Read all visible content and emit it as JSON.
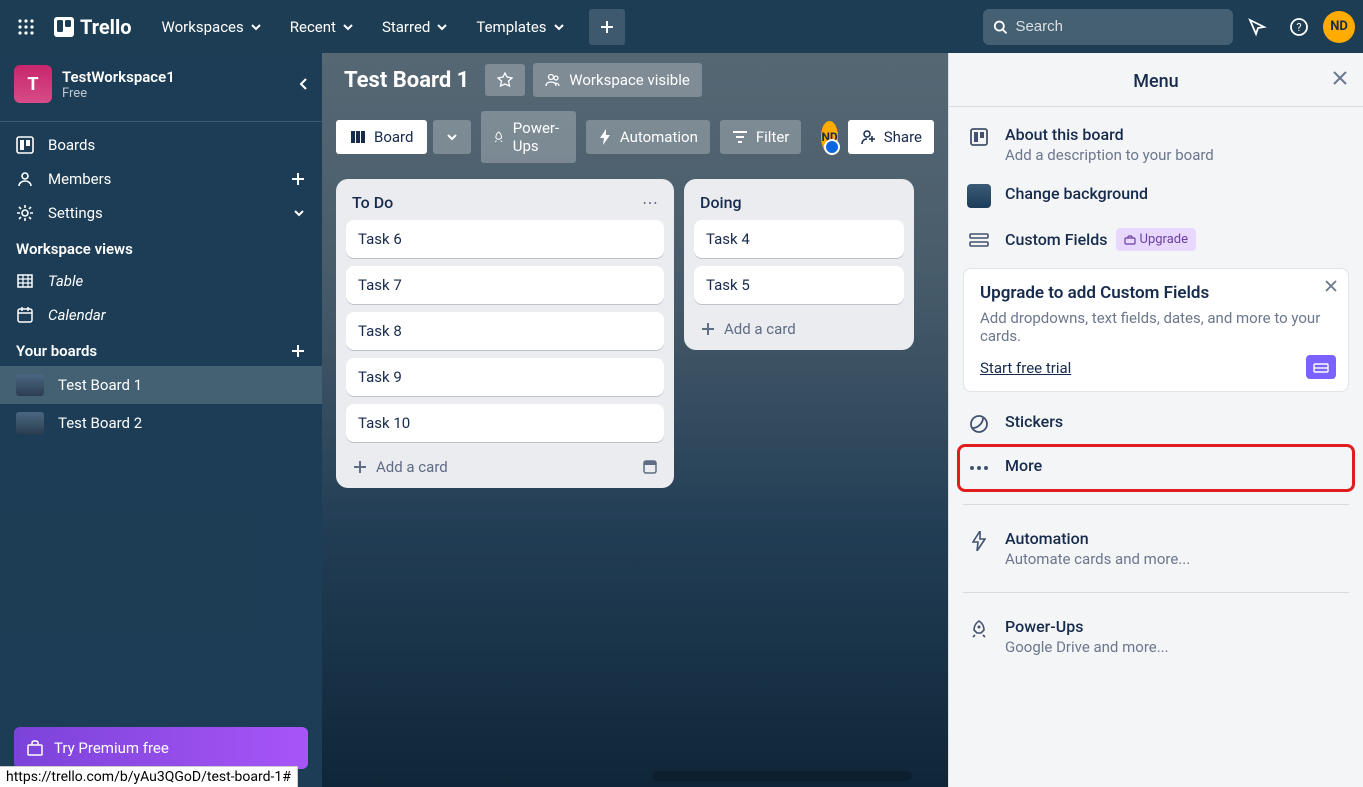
{
  "topbar": {
    "logo": "Trello",
    "nav": [
      "Workspaces",
      "Recent",
      "Starred",
      "Templates"
    ],
    "search_placeholder": "Search",
    "avatar": "ND"
  },
  "sidebar": {
    "workspace": {
      "initial": "T",
      "name": "TestWorkspace1",
      "plan": "Free"
    },
    "items": {
      "boards": "Boards",
      "members": "Members",
      "settings": "Settings"
    },
    "views_title": "Workspace views",
    "views": {
      "table": "Table",
      "calendar": "Calendar"
    },
    "boards_title": "Your boards",
    "boards": [
      "Test Board 1",
      "Test Board 2"
    ],
    "premium": "Try Premium free"
  },
  "board": {
    "title": "Test Board 1",
    "visibility": "Workspace visible",
    "view_label": "Board",
    "powerups": "Power-Ups",
    "automation": "Automation",
    "filter": "Filter",
    "share": "Share",
    "member": "ND"
  },
  "lists": [
    {
      "title": "To Do",
      "cards": [
        "Task 6",
        "Task 7",
        "Task 8",
        "Task 9",
        "Task 10"
      ],
      "add": "Add a card",
      "show_template": true
    },
    {
      "title": "Doing",
      "cards": [
        "Task 4",
        "Task 5"
      ],
      "add": "Add a card",
      "show_template": false,
      "partial": true
    }
  ],
  "menu": {
    "title": "Menu",
    "about": {
      "label": "About this board",
      "sub": "Add a description to your board"
    },
    "background": "Change background",
    "custom_fields": "Custom Fields",
    "upgrade_pill": "Upgrade",
    "promo": {
      "title": "Upgrade to add Custom Fields",
      "text": "Add dropdowns, text fields, dates, and more to your cards.",
      "link": "Start free trial"
    },
    "stickers": "Stickers",
    "more": "More",
    "automation": {
      "label": "Automation",
      "sub": "Automate cards and more..."
    },
    "powerups": {
      "label": "Power-Ups",
      "sub": "Google Drive and more..."
    }
  },
  "status_url": "https://trello.com/b/yAu3QGoD/test-board-1#"
}
